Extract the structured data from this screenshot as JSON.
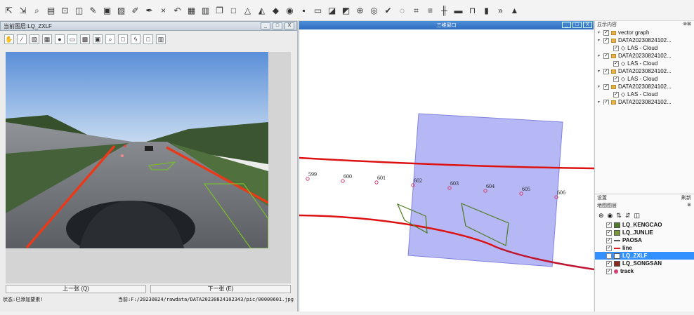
{
  "toolbar": {
    "icons": [
      "pointer-icon",
      "select-icon",
      "identify-icon",
      "page-icon",
      "map-icon",
      "frame-icon",
      "edit-icon",
      "layer-icon",
      "image-icon",
      "draw-icon",
      "pen-icon",
      "close-icon",
      "undo-icon",
      "save-icon",
      "print-icon",
      "view3d-icon",
      "square-icon",
      "terrain-icon",
      "mountain-icon",
      "paint-icon",
      "camera-icon",
      "capture-icon",
      "picture-icon",
      "chart-icon",
      "photo-icon",
      "zoom-icon",
      "web-icon",
      "ok-icon",
      "target-icon",
      "measure-icon",
      "road-icon",
      "grid-icon",
      "tunnel-icon",
      "phone-icon",
      "book-icon",
      "more-icon",
      "extra-icon"
    ],
    "glyphs": [
      "⇱",
      "⇲",
      "⌕",
      "▤",
      "⊡",
      "◫",
      "✎",
      "▣",
      "▨",
      "✐",
      "✒",
      "×",
      "↶",
      "▦",
      "▥",
      "❐",
      "□",
      "△",
      "◭",
      "◆",
      "◉",
      "▪",
      "▭",
      "◪",
      "◩",
      "⊕",
      "◎",
      "✔",
      "◌",
      "⌗",
      "≡",
      "╫",
      "▬",
      "⊓",
      "▮",
      "»",
      "▲"
    ]
  },
  "left_panel": {
    "title": "当前图层:LQ_ZXLF",
    "win_buttons": [
      "_",
      "□",
      "X"
    ],
    "image_tools": [
      "✋",
      "∕",
      "▧",
      "▦",
      "●",
      "▭",
      "▩",
      "▣",
      "⌕",
      "□",
      "ϟ",
      "□",
      "▥"
    ],
    "prev_button": "上一张 (Q)",
    "next_button": "下一张 (E)",
    "status_left": "状态:已添加要素!",
    "status_right": "当前:F:/20230824/rawdata/DATA20230824102343/pic/00000601.jpg"
  },
  "map_view": {
    "title": "三维窗口",
    "win_buttons": [
      "_",
      "□",
      "X"
    ],
    "points": [
      "599",
      "600",
      "601",
      "602",
      "603",
      "604",
      "605",
      "606"
    ]
  },
  "content_panel": {
    "title": "显示内容",
    "items": [
      {
        "label": "vector graph",
        "kind": "folder",
        "indent": 0
      },
      {
        "label": "DATA20230824102...",
        "kind": "folder",
        "indent": 0
      },
      {
        "label": "LAS - Cloud",
        "kind": "cloud",
        "indent": 1
      },
      {
        "label": "DATA20230824102...",
        "kind": "folder",
        "indent": 0
      },
      {
        "label": "LAS - Cloud",
        "kind": "cloud",
        "indent": 1
      },
      {
        "label": "DATA20230824102...",
        "kind": "folder",
        "indent": 0
      },
      {
        "label": "LAS - Cloud",
        "kind": "cloud",
        "indent": 1
      },
      {
        "label": "DATA20230824102...",
        "kind": "folder",
        "indent": 0
      },
      {
        "label": "LAS - Cloud",
        "kind": "cloud",
        "indent": 1
      },
      {
        "label": "DATA20230824102...",
        "kind": "folder",
        "indent": 0
      }
    ],
    "settings_label": "设置",
    "refresh_label": "刷新"
  },
  "layers_panel": {
    "title": "地图图层",
    "tools": [
      "⊕",
      "◉",
      "⇅",
      "⇵",
      "◫"
    ],
    "layers": [
      {
        "label": "LQ_KENGCAO",
        "color": "#4f7a2a",
        "type": "fill",
        "selected": false
      },
      {
        "label": "LQ_JUNLIE",
        "color": "#7a9a3a",
        "type": "fill",
        "selected": false
      },
      {
        "label": "PAOSA",
        "color": "#555555",
        "type": "line",
        "selected": false
      },
      {
        "label": "line",
        "color": "#e02020",
        "type": "line",
        "selected": false
      },
      {
        "label": "LQ_ZXLF",
        "color": "#ffffff",
        "type": "fill",
        "selected": true
      },
      {
        "label": "LQ_SONGSAN",
        "color": "#8b2a1a",
        "type": "fill",
        "selected": false
      },
      {
        "label": "track",
        "color": "#d04070",
        "type": "dot",
        "selected": false
      }
    ]
  }
}
